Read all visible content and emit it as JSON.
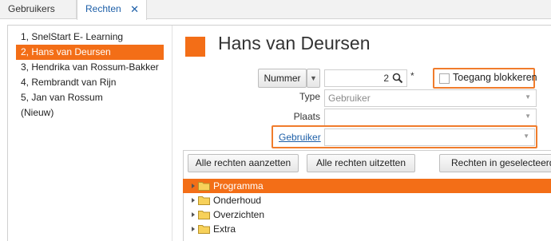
{
  "tabs": [
    {
      "label": "Gebruikers"
    },
    {
      "label": "Rechten",
      "close": "✕"
    }
  ],
  "users": [
    {
      "label": "1, SnelStart E- Learning"
    },
    {
      "label": "2, Hans van Deursen"
    },
    {
      "label": "3, Hendrika van Rossum-Bakker"
    },
    {
      "label": "4, Rembrandt van Rijn"
    },
    {
      "label": "5, Jan van Rossum"
    },
    {
      "label": "(Nieuw)"
    }
  ],
  "selected_user_index": 1,
  "detail": {
    "title": "Hans van Deursen",
    "number_button": "Nummer",
    "number_dropdown_icon": "chevron-down-icon",
    "number_value": "2",
    "required_marker": "*",
    "block_label": "Toegang blokkeren",
    "block_checked": false,
    "type_label": "Type",
    "type_value": "Gebruiker",
    "plaats_label": "Plaats",
    "plaats_value": "",
    "gebruiker_link": "Gebruiker",
    "gebruiker_value": ""
  },
  "rights": {
    "buttons": [
      "Alle rechten aanzetten",
      "Alle rechten uitzetten",
      "Rechten in geselecteerde"
    ],
    "tree": [
      {
        "label": "Programma"
      },
      {
        "label": "Onderhoud"
      },
      {
        "label": "Overzichten"
      },
      {
        "label": "Extra"
      }
    ],
    "selected_index": 0
  },
  "colors": {
    "accent": "#f36e17",
    "highlight_border": "#f07c2c",
    "link": "#1d5fa8"
  }
}
